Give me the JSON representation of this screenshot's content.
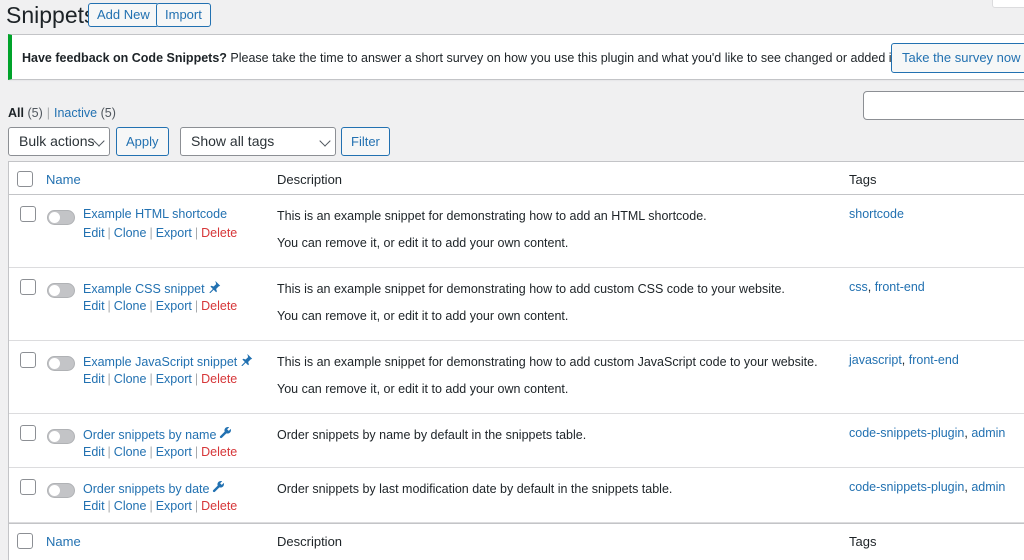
{
  "header": {
    "title": "Snippets",
    "add_new": "Add New",
    "import": "Import"
  },
  "notice": {
    "strong": "Have feedback on Code Snippets?",
    "text": " Please take the time to answer a short survey on how you use this plugin and what you'd like to see changed or added in the future.",
    "button": "Take the survey now"
  },
  "views": {
    "all_label": "All",
    "all_count": "(5)",
    "separator": "|",
    "inactive_label": "Inactive",
    "inactive_count": "(5)"
  },
  "tablenav": {
    "bulk_actions": "Bulk actions",
    "apply": "Apply",
    "tags_filter": "Show all tags",
    "filter": "Filter"
  },
  "table": {
    "columns": {
      "name": "Name",
      "description": "Description",
      "tags": "Tags"
    },
    "row_actions": {
      "edit": "Edit",
      "clone": "Clone",
      "export": "Export",
      "delete": "Delete"
    },
    "rows": [
      {
        "name": "Example HTML shortcode",
        "icon": "",
        "desc1": "This is an example snippet for demonstrating how to add an HTML shortcode.",
        "desc2": "You can remove it, or edit it to add your own content.",
        "tag1": "shortcode",
        "tag2": ""
      },
      {
        "name": "Example CSS snippet",
        "icon": "pin-icon",
        "desc1": "This is an example snippet for demonstrating how to add custom CSS code to your website.",
        "desc2": "You can remove it, or edit it to add your own content.",
        "tag1": "css",
        "tag2": "front-end"
      },
      {
        "name": "Example JavaScript snippet",
        "icon": "pin-icon",
        "desc1": "This is an example snippet for demonstrating how to add custom JavaScript code to your website.",
        "desc2": "You can remove it, or edit it to add your own content.",
        "tag1": "javascript",
        "tag2": "front-end"
      },
      {
        "name": "Order snippets by name",
        "icon": "wrench-icon",
        "desc1": "Order snippets by name by default in the snippets table.",
        "desc2": "",
        "tag1": "code-snippets-plugin",
        "tag2": "admin"
      },
      {
        "name": "Order snippets by date",
        "icon": "wrench-icon",
        "desc1": "Order snippets by last modification date by default in the snippets table.",
        "desc2": "",
        "tag1": "code-snippets-plugin",
        "tag2": "admin"
      }
    ]
  }
}
